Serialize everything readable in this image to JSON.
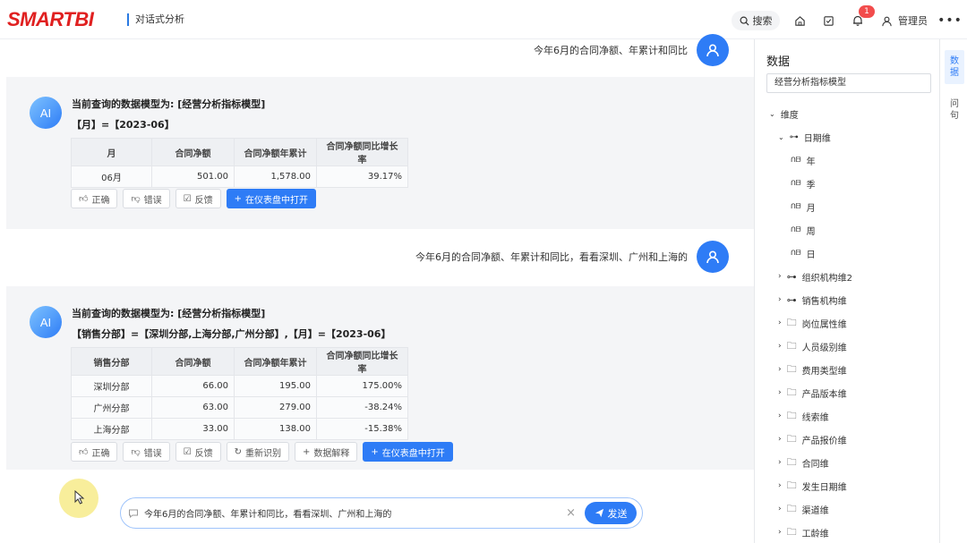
{
  "header": {
    "logo": "SMARTBI",
    "app_title": "对话式分析",
    "search_label": "搜索",
    "notification_count": "1",
    "user_name": "管理员"
  },
  "chat": {
    "q1": "今年6月的合同净额、年累计和同比",
    "r1": {
      "model_line": "当前查询的数据模型为: [经营分析指标模型]",
      "filter_line": "【月】=【2023-06】",
      "columns": [
        "月",
        "合同净额",
        "合同净额年累计",
        "合同净额同比增长率"
      ],
      "rows": [
        [
          "06月",
          "501.00",
          "1,578.00",
          "39.17%"
        ]
      ],
      "actions": [
        "正确",
        "错误",
        "反馈",
        "在仪表盘中打开"
      ]
    },
    "q2": "今年6月的合同净额、年累计和同比，看看深圳、广州和上海的",
    "r2": {
      "model_line": "当前查询的数据模型为: [经营分析指标模型]",
      "filter_line": "【销售分部】=【深圳分部,上海分部,广州分部】,【月】=【2023-06】",
      "columns": [
        "销售分部",
        "合同净额",
        "合同净额年累计",
        "合同净额同比增长率"
      ],
      "rows": [
        [
          "深圳分部",
          "66.00",
          "195.00",
          "175.00%"
        ],
        [
          "广州分部",
          "63.00",
          "279.00",
          "-38.24%"
        ],
        [
          "上海分部",
          "33.00",
          "138.00",
          "-15.38%"
        ]
      ],
      "actions": [
        "正确",
        "错误",
        "反馈",
        "重新识别",
        "数据解释",
        "在仪表盘中打开"
      ]
    },
    "ai_avatar_label": "AI",
    "input_value": "今年6月的合同净额、年累计和同比，看看深圳、广州和上海的",
    "send_label": "发送"
  },
  "panel": {
    "title": "数据",
    "model": "经营分析指标模型",
    "dimension_label": "维度",
    "date_dim": "日期维",
    "date_levels": [
      "年",
      "季",
      "月",
      "周",
      "日"
    ],
    "dims": [
      "组织机构维2",
      "销售机构维",
      "岗位属性维",
      "人员级别维",
      "费用类型维",
      "产品版本维",
      "线索维",
      "产品报价维",
      "合同维",
      "发生日期维",
      "渠道维",
      "工龄维"
    ]
  },
  "vtabs": [
    "数据",
    "问句"
  ]
}
